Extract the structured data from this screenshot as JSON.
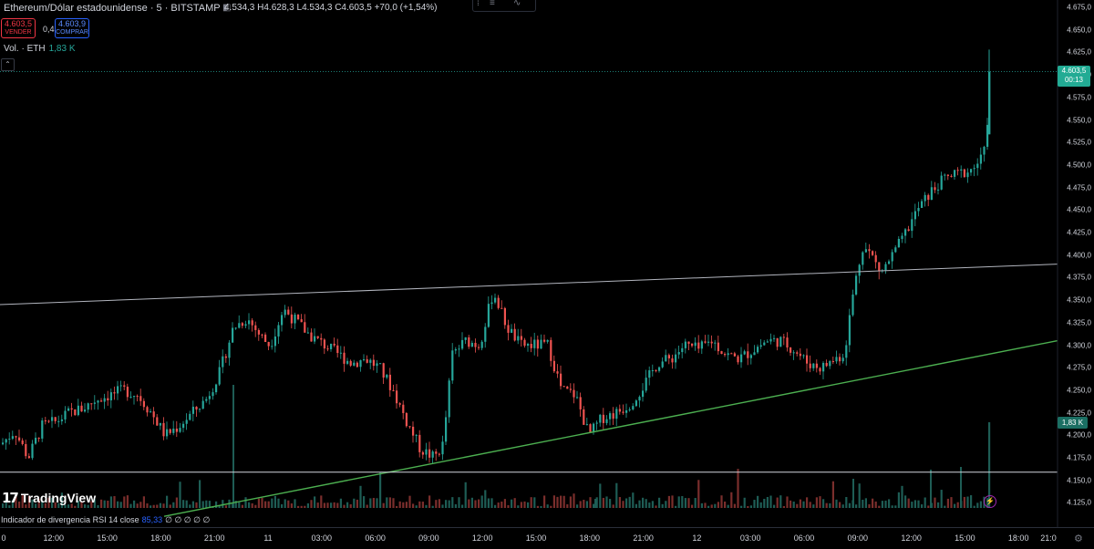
{
  "header": {
    "symbol": "Ethereum/Dólar estadounidense · 5 · BITSTAMP",
    "ohlc": "4.534,3 H4.628,3 L4.534,3 C4.603,5 +70,0 (+1,54%)",
    "sell_price": "4.603,5",
    "sell_label": "VENDER",
    "spread": "0,4",
    "buy_price": "4.603,9",
    "buy_label": "COMPRAR",
    "volume_label": "Vol. · ETH",
    "volume_value": "1,83 K"
  },
  "price_axis": {
    "ticks": [
      "4.675,0",
      "4.650,0",
      "4.625,0",
      "4.600,0",
      "4.575,0",
      "4.550,0",
      "4.525,0",
      "4.500,0",
      "4.475,0",
      "4.450,0",
      "4.425,0",
      "4.400,0",
      "4.375,0",
      "4.350,0",
      "4.325,0",
      "4.300,0",
      "4.275,0",
      "4.250,0",
      "4.225,0",
      "4.200,0",
      "4.175,0",
      "4.150,0",
      "4.125,0"
    ],
    "current_price": "4.603,5",
    "countdown": "00:13",
    "volume_tag": "1,83 K"
  },
  "time_axis": {
    "ticks": [
      "0",
      "12:00",
      "15:00",
      "18:00",
      "21:00",
      "11",
      "03:00",
      "06:00",
      "09:00",
      "12:00",
      "15:00",
      "18:00",
      "21:00",
      "12",
      "03:00",
      "06:00",
      "09:00",
      "12:00",
      "15:00",
      "18:00",
      "21:0"
    ]
  },
  "indicator": {
    "label": "Indicador de divergencia RSI 14 close",
    "value": "85,33",
    "dots": "∅ ∅ ∅ ∅ ∅"
  },
  "branding": {
    "name": "TradingView",
    "mark": "17"
  },
  "colors": {
    "up": "#26a69a",
    "down": "#ef5350",
    "background": "#000000",
    "support_line": "#4caf50",
    "resistance_line": "#b2b5be"
  },
  "chart_data": {
    "type": "candlestick",
    "title": "Ethereum/Dólar estadounidense · 5 · BITSTAMP",
    "ylim": [
      4110,
      4680
    ],
    "close_path": [
      [
        0,
        4190
      ],
      [
        15,
        4205
      ],
      [
        30,
        4175
      ],
      [
        45,
        4210
      ],
      [
        60,
        4215
      ],
      [
        75,
        4225
      ],
      [
        90,
        4230
      ],
      [
        105,
        4240
      ],
      [
        120,
        4245
      ],
      [
        135,
        4250
      ],
      [
        150,
        4245
      ],
      [
        165,
        4225
      ],
      [
        180,
        4200
      ],
      [
        195,
        4210
      ],
      [
        210,
        4225
      ],
      [
        225,
        4240
      ],
      [
        240,
        4270
      ],
      [
        255,
        4320
      ],
      [
        270,
        4330
      ],
      [
        285,
        4310
      ],
      [
        295,
        4300
      ],
      [
        310,
        4340
      ],
      [
        325,
        4325
      ],
      [
        340,
        4310
      ],
      [
        355,
        4300
      ],
      [
        370,
        4290
      ],
      [
        385,
        4280
      ],
      [
        400,
        4285
      ],
      [
        415,
        4275
      ],
      [
        430,
        4250
      ],
      [
        445,
        4215
      ],
      [
        460,
        4185
      ],
      [
        475,
        4175
      ],
      [
        485,
        4190
      ],
      [
        495,
        4290
      ],
      [
        510,
        4305
      ],
      [
        525,
        4300
      ],
      [
        540,
        4360
      ],
      [
        555,
        4320
      ],
      [
        570,
        4300
      ],
      [
        585,
        4300
      ],
      [
        600,
        4300
      ],
      [
        615,
        4250
      ],
      [
        630,
        4245
      ],
      [
        645,
        4200
      ],
      [
        660,
        4220
      ],
      [
        675,
        4225
      ],
      [
        690,
        4235
      ],
      [
        705,
        4255
      ],
      [
        720,
        4280
      ],
      [
        735,
        4285
      ],
      [
        750,
        4300
      ],
      [
        765,
        4295
      ],
      [
        780,
        4305
      ],
      [
        795,
        4290
      ],
      [
        810,
        4285
      ],
      [
        825,
        4295
      ],
      [
        840,
        4305
      ],
      [
        855,
        4305
      ],
      [
        870,
        4295
      ],
      [
        885,
        4280
      ],
      [
        900,
        4275
      ],
      [
        915,
        4285
      ],
      [
        925,
        4290
      ],
      [
        935,
        4360
      ],
      [
        945,
        4410
      ],
      [
        955,
        4400
      ],
      [
        965,
        4380
      ],
      [
        975,
        4395
      ],
      [
        990,
        4420
      ],
      [
        1005,
        4450
      ],
      [
        1020,
        4470
      ],
      [
        1035,
        4485
      ],
      [
        1050,
        4490
      ],
      [
        1065,
        4495
      ],
      [
        1078,
        4510
      ],
      [
        1083,
        4560
      ],
      [
        1086,
        4604
      ]
    ],
    "resistance_line": [
      [
        0,
        4345
      ],
      [
        1160,
        4390
      ]
    ],
    "support_line": [
      [
        180,
        4110
      ],
      [
        1160,
        4305
      ]
    ],
    "level_line": 4159,
    "last_price_line": 4603.5
  }
}
